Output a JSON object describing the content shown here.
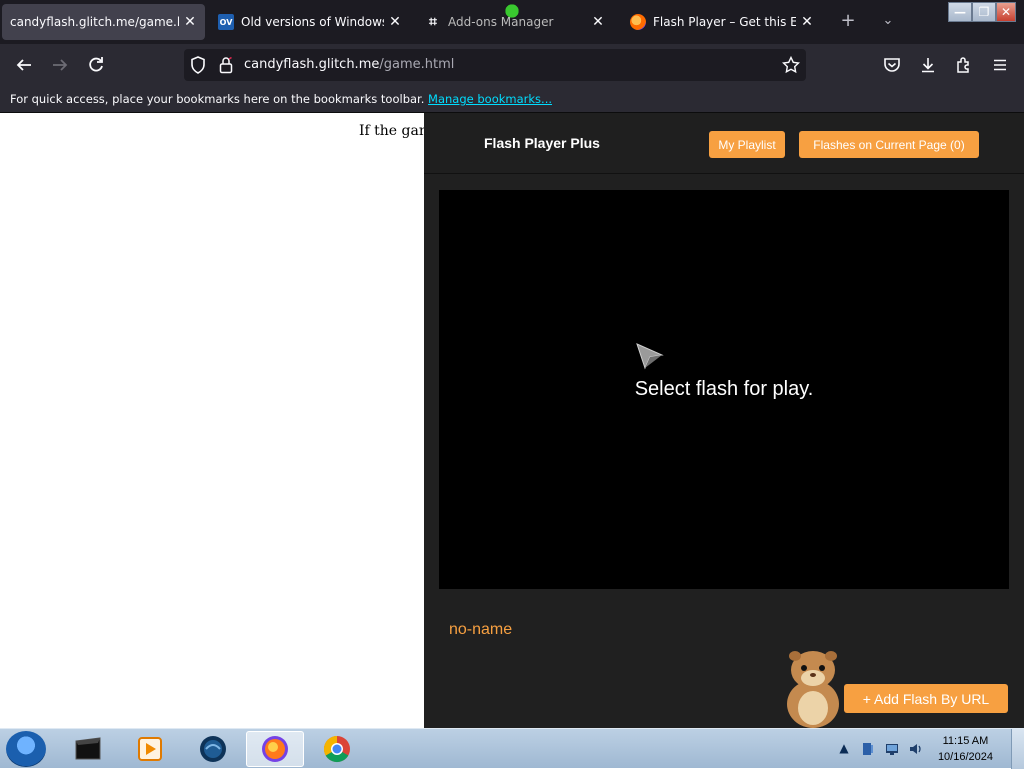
{
  "tabs": [
    {
      "title": "candyflash.glitch.me/game.html",
      "favicon": "none",
      "active": true
    },
    {
      "title": "Old versions of Windows, M",
      "favicon": "ov-icon",
      "active": false
    },
    {
      "title": "Add-ons Manager",
      "favicon": "puzzle-icon",
      "active": false
    },
    {
      "title": "Flash Player – Get this Exte",
      "favicon": "firefox-icon",
      "active": false
    }
  ],
  "tab_close_glyph": "✕",
  "window_controls": {
    "minimize": "—",
    "maximize": "❐",
    "close": "✕"
  },
  "nav": {
    "url_host": "candyflash.glitch.me",
    "url_path": "/game.html"
  },
  "bookmarks_bar": {
    "message": "For quick access, place your bookmarks here on the bookmarks toolbar.",
    "link": "Manage bookmarks..."
  },
  "page": {
    "text": "If the game"
  },
  "flash_panel": {
    "title": "Flash Player Plus",
    "playlist_button": "My Playlist",
    "flashes_button": "Flashes on Current Page (0)",
    "player_message": "Select flash for play.",
    "flash_name": "no-name",
    "add_url_button": "+ Add Flash By URL",
    "accent_color": "#f7a041"
  },
  "taskbar": {
    "apps": [
      "media-center-icon",
      "media-player-icon",
      "browser-icon",
      "firefox-icon",
      "chrome-icon"
    ],
    "active_app": "firefox-icon",
    "clock_time": "11:15 AM",
    "clock_date": "10/16/2024"
  }
}
